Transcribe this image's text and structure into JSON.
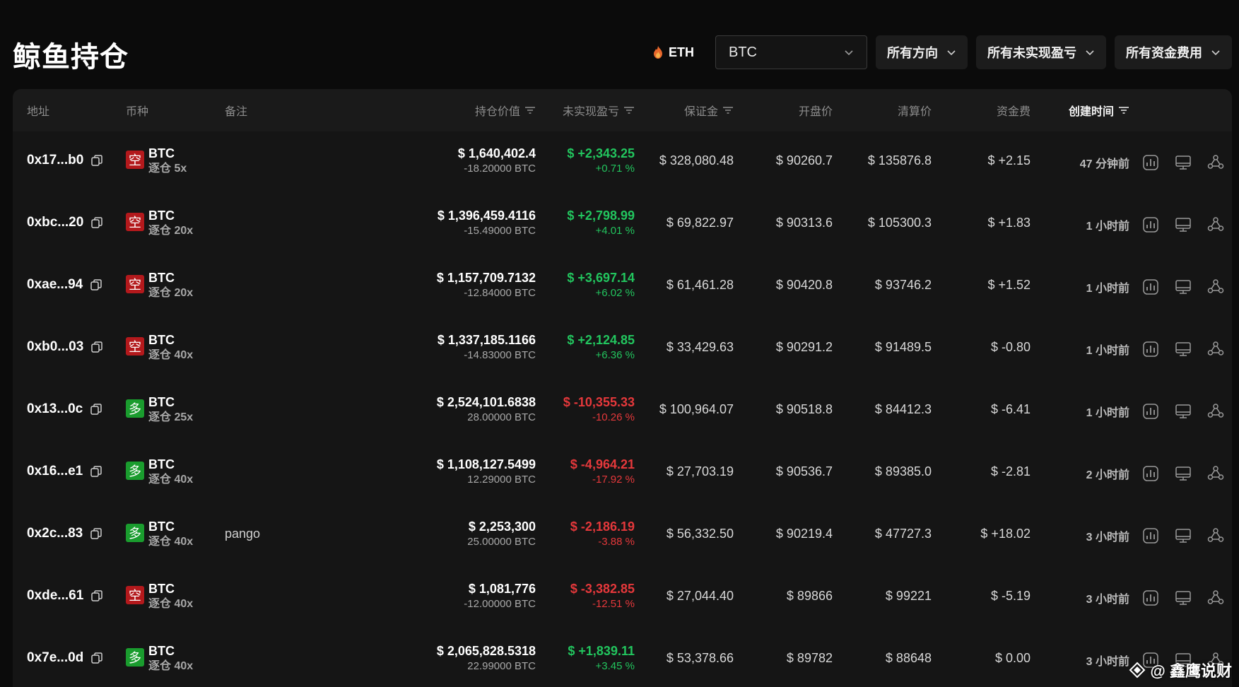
{
  "page": {
    "title": "鲸鱼持仓"
  },
  "toolbar": {
    "eth_label": "ETH",
    "coin_select": "BTC",
    "direction_filter": "所有方向",
    "pnl_filter": "所有未实现盈亏",
    "funding_filter": "所有资金费用"
  },
  "table": {
    "headers": {
      "address": "地址",
      "coin": "币种",
      "note": "备注",
      "position_value": "持仓价值",
      "unrealized_pnl": "未实现盈亏",
      "margin": "保证金",
      "entry_price": "开盘价",
      "liq_price": "清算价",
      "funding": "资金费",
      "created": "创建时间"
    },
    "rows": [
      {
        "address": "0x17...b0",
        "side": "空",
        "side_type": "short",
        "coin": "BTC",
        "leverage": "逐仓 5x",
        "note": "",
        "value": "$ 1,640,402.4",
        "size": "-18.20000 BTC",
        "pnl": "$ +2,343.25",
        "pnl_pct": "+0.71 %",
        "pnl_sign": "pos",
        "margin": "$ 328,080.48",
        "entry": "$ 90260.7",
        "liq": "$ 135876.8",
        "funding": "$ +2.15",
        "funding_sign": "pos",
        "time": "47 分钟前"
      },
      {
        "address": "0xbc...20",
        "side": "空",
        "side_type": "short",
        "coin": "BTC",
        "leverage": "逐仓 20x",
        "note": "",
        "value": "$ 1,396,459.4116",
        "size": "-15.49000 BTC",
        "pnl": "$ +2,798.99",
        "pnl_pct": "+4.01 %",
        "pnl_sign": "pos",
        "margin": "$ 69,822.97",
        "entry": "$ 90313.6",
        "liq": "$ 105300.3",
        "funding": "$ +1.83",
        "funding_sign": "pos",
        "time": "1 小时前"
      },
      {
        "address": "0xae...94",
        "side": "空",
        "side_type": "short",
        "coin": "BTC",
        "leverage": "逐仓 20x",
        "note": "",
        "value": "$ 1,157,709.7132",
        "size": "-12.84000 BTC",
        "pnl": "$ +3,697.14",
        "pnl_pct": "+6.02 %",
        "pnl_sign": "pos",
        "margin": "$ 61,461.28",
        "entry": "$ 90420.8",
        "liq": "$ 93746.2",
        "funding": "$ +1.52",
        "funding_sign": "pos",
        "time": "1 小时前"
      },
      {
        "address": "0xb0...03",
        "side": "空",
        "side_type": "short",
        "coin": "BTC",
        "leverage": "逐仓 40x",
        "note": "",
        "value": "$ 1,337,185.1166",
        "size": "-14.83000 BTC",
        "pnl": "$ +2,124.85",
        "pnl_pct": "+6.36 %",
        "pnl_sign": "pos",
        "margin": "$ 33,429.63",
        "entry": "$ 90291.2",
        "liq": "$ 91489.5",
        "funding": "$ -0.80",
        "funding_sign": "neg",
        "time": "1 小时前"
      },
      {
        "address": "0x13...0c",
        "side": "多",
        "side_type": "long",
        "coin": "BTC",
        "leverage": "逐仓 25x",
        "note": "",
        "value": "$ 2,524,101.6838",
        "size": "28.00000 BTC",
        "pnl": "$ -10,355.33",
        "pnl_pct": "-10.26 %",
        "pnl_sign": "neg",
        "margin": "$ 100,964.07",
        "entry": "$ 90518.8",
        "liq": "$ 84412.3",
        "funding": "$ -6.41",
        "funding_sign": "neg",
        "time": "1 小时前"
      },
      {
        "address": "0x16...e1",
        "side": "多",
        "side_type": "long",
        "coin": "BTC",
        "leverage": "逐仓 40x",
        "note": "",
        "value": "$ 1,108,127.5499",
        "size": "12.29000 BTC",
        "pnl": "$ -4,964.21",
        "pnl_pct": "-17.92 %",
        "pnl_sign": "neg",
        "margin": "$ 27,703.19",
        "entry": "$ 90536.7",
        "liq": "$ 89385.0",
        "funding": "$ -2.81",
        "funding_sign": "neg",
        "time": "2 小时前"
      },
      {
        "address": "0x2c...83",
        "side": "多",
        "side_type": "long",
        "coin": "BTC",
        "leverage": "逐仓 40x",
        "note": "pango",
        "value": "$ 2,253,300",
        "size": "25.00000 BTC",
        "pnl": "$ -2,186.19",
        "pnl_pct": "-3.88 %",
        "pnl_sign": "neg",
        "margin": "$ 56,332.50",
        "entry": "$ 90219.4",
        "liq": "$ 47727.3",
        "funding": "$ +18.02",
        "funding_sign": "pos",
        "time": "3 小时前"
      },
      {
        "address": "0xde...61",
        "side": "空",
        "side_type": "short",
        "coin": "BTC",
        "leverage": "逐仓 40x",
        "note": "",
        "value": "$ 1,081,776",
        "size": "-12.00000 BTC",
        "pnl": "$ -3,382.85",
        "pnl_pct": "-12.51 %",
        "pnl_sign": "neg",
        "margin": "$ 27,044.40",
        "entry": "$ 89866",
        "liq": "$ 99221",
        "funding": "$ -5.19",
        "funding_sign": "neg",
        "time": "3 小时前"
      },
      {
        "address": "0x7e...0d",
        "side": "多",
        "side_type": "long",
        "coin": "BTC",
        "leverage": "逐仓 40x",
        "note": "",
        "value": "$ 2,065,828.5318",
        "size": "22.99000 BTC",
        "pnl": "$ +1,839.11",
        "pnl_pct": "+3.45 %",
        "pnl_sign": "pos",
        "margin": "$ 53,378.66",
        "entry": "$ 89782",
        "liq": "$ 88648",
        "funding": "$ 0.00",
        "funding_sign": "neutral",
        "time": "3 小时前"
      }
    ]
  },
  "watermark": "@ 鑫鹰说财",
  "colors": {
    "positive": "#22c55e",
    "negative": "#e5383b",
    "short_badge": "#b3191c",
    "long_badge": "#1a9c2e"
  }
}
